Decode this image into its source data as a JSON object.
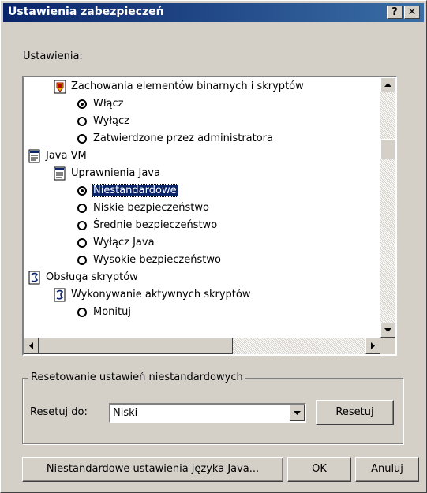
{
  "window": {
    "title": "Ustawienia zabezpieczeń",
    "help_label": "?",
    "close_label": "✕"
  },
  "settings_label": "Ustawienia:",
  "tree": {
    "binary_behaviors": "Zachowania elementów binarnych i skryptów",
    "opt_enable": "Włącz",
    "opt_disable": "Wyłącz",
    "opt_admin_approved": "Zatwierdzone przez administratora",
    "java_vm": "Java VM",
    "java_permissions": "Uprawnienia Java",
    "opt_custom": "Niestandardowe",
    "opt_low": "Niskie bezpieczeństwo",
    "opt_medium": "Średnie bezpieczeństwo",
    "opt_disable_java": "Wyłącz Java",
    "opt_high": "Wysokie bezpieczeństwo",
    "scripting": "Obsługa skryptów",
    "active_scripting": "Wykonywanie aktywnych skryptów",
    "opt_prompt_partial": "Monituj"
  },
  "reset_group": {
    "legend": "Resetowanie ustawień niestandardowych",
    "reset_to_label": "Resetuj do:",
    "reset_to_value": "Niski",
    "reset_button": "Resetuj"
  },
  "buttons": {
    "java_custom": "Niestandardowe ustawienia języka Java...",
    "ok": "OK",
    "cancel": "Anuluj"
  },
  "colors": {
    "title_start": "#0a246a",
    "title_end": "#3a6ea5",
    "selection": "#0a246a",
    "face": "#d4d0c8"
  }
}
